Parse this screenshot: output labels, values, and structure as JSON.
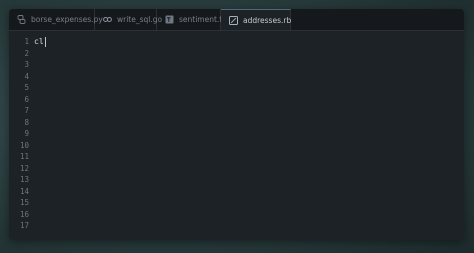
{
  "tabs": [
    {
      "label": "borse_expenses.py",
      "icon": "python-file-icon",
      "active": false
    },
    {
      "label": "write_sql.go",
      "icon": "go-file-icon",
      "active": false
    },
    {
      "label": "sentiment.ts",
      "icon": "typescript-file-icon",
      "active": false
    },
    {
      "label": "addresses.rb",
      "icon": "ruby-file-icon",
      "active": true
    }
  ],
  "line_numbers": [
    "1",
    "2",
    "3",
    "4",
    "5",
    "6",
    "7",
    "8",
    "9",
    "10",
    "11",
    "12",
    "13",
    "14",
    "15",
    "16",
    "17"
  ],
  "code_lines": [
    "cl"
  ],
  "colors": {
    "background": "#2c4142",
    "editor": "#1c2226",
    "tabbar": "#15191c",
    "text": "#d6dde4",
    "line_number": "#6b7680"
  }
}
